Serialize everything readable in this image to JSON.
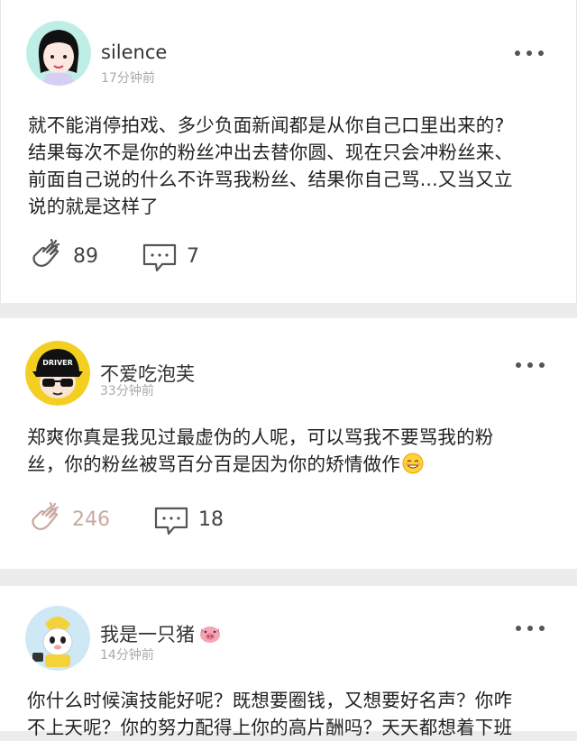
{
  "posts": [
    {
      "user": "silence",
      "time": "17分钟前",
      "lines": [
        "就不能消停拍戏、多少负面新闻都是从你自己口里出来的?",
        "结果每次不是你的粉丝冲出去替你圆、现在只会冲粉丝来、",
        "前面自己说的什么不许骂我粉丝、结果你自己骂...又当又立",
        "说的就是这样了"
      ],
      "likes": "89",
      "comments": "7",
      "liked": false
    },
    {
      "user": "不爱吃泡芙",
      "time": "33分钟前",
      "lines": [
        "郑爽你真是我见过最虚伪的人呢，可以骂我不要骂我的粉",
        "丝，你的粉丝被骂百分百是因为你的矫情做作"
      ],
      "likes": "246",
      "comments": "18",
      "liked": true,
      "avatar_cap_text": "DRIVER"
    },
    {
      "user": "我是一只猪",
      "time": "14分钟前",
      "lines": [
        "你什么时候演技能好呢？既想要圈钱，又想要好名声？你咋",
        "不上天呢？你的努力配得上你的高片酬吗？天天都想着下班"
      ]
    }
  ],
  "icons": {
    "more": "more-dots-icon",
    "like": "clap-icon",
    "comment": "comment-icon",
    "emoji": "smile-emoji-icon",
    "pig": "pig-emoji-icon"
  },
  "colors": {
    "background": "#ececec",
    "card": "#ffffff",
    "liked": "#c9a9a0",
    "meta": "#aaaaaa"
  }
}
